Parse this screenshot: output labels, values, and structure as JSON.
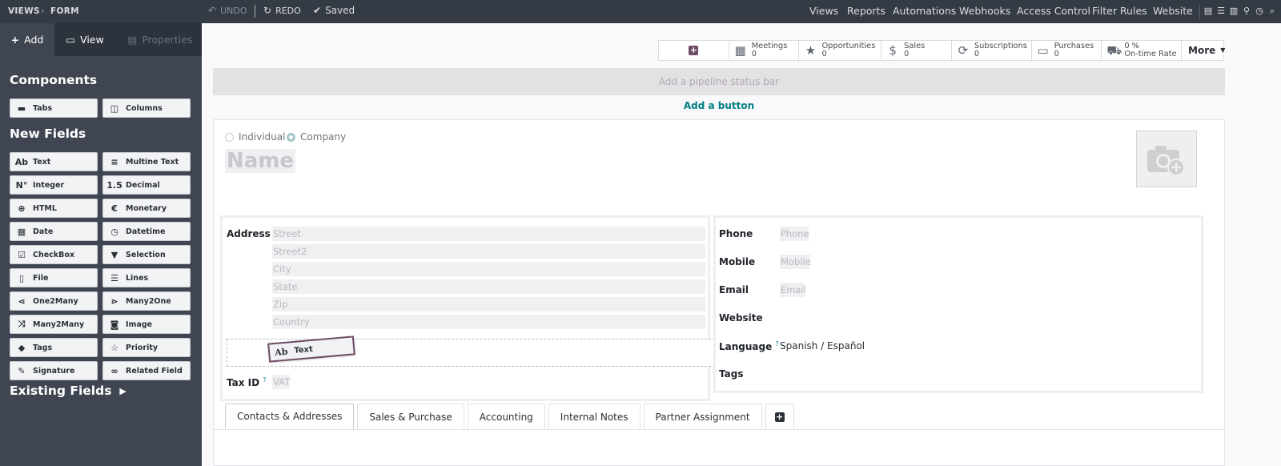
{
  "topbar": {
    "breadcrumb": "VIEWS",
    "crumb_sep": "›",
    "current": "FORM",
    "undo": "UNDO",
    "redo": "REDO",
    "saved": "Saved",
    "menu": [
      "Views",
      "Reports",
      "Automations",
      "Webhooks",
      "Access Control",
      "Filter Rules",
      "Website"
    ]
  },
  "sidebar": {
    "tabs": [
      {
        "label": "Add",
        "icon": "plus-icon"
      },
      {
        "label": "View",
        "icon": "monitor-icon"
      },
      {
        "label": "Properties",
        "icon": "sliders-icon"
      }
    ],
    "components_title": "Components",
    "components": [
      {
        "label": "Tabs",
        "icon": "tabs-icon"
      },
      {
        "label": "Columns",
        "icon": "columns-icon"
      }
    ],
    "new_fields_title": "New Fields",
    "new_fields": [
      {
        "label": "Text",
        "glyph": "Ab"
      },
      {
        "label": "Multine Text",
        "glyph": "≡"
      },
      {
        "label": "Integer",
        "glyph": "N°"
      },
      {
        "label": "Decimal",
        "glyph": "1.5"
      },
      {
        "label": "HTML",
        "glyph": "⊕"
      },
      {
        "label": "Monetary",
        "glyph": "€"
      },
      {
        "label": "Date",
        "glyph": "▦"
      },
      {
        "label": "Datetime",
        "glyph": "◷"
      },
      {
        "label": "CheckBox",
        "glyph": "☑"
      },
      {
        "label": "Selection",
        "glyph": "▼"
      },
      {
        "label": "File",
        "glyph": "▯"
      },
      {
        "label": "Lines",
        "glyph": "☰"
      },
      {
        "label": "One2Many",
        "glyph": "⋖"
      },
      {
        "label": "Many2One",
        "glyph": "⋗"
      },
      {
        "label": "Many2Many",
        "glyph": "⤨"
      },
      {
        "label": "Image",
        "glyph": "◙"
      },
      {
        "label": "Tags",
        "glyph": "◆"
      },
      {
        "label": "Priority",
        "glyph": "☆"
      },
      {
        "label": "Signature",
        "glyph": "✎"
      },
      {
        "label": "Related Field",
        "glyph": "∞"
      }
    ],
    "existing_fields_title": "Existing Fields"
  },
  "stat_buttons": [
    {
      "label": "",
      "value": "",
      "icon": "plus-square-icon"
    },
    {
      "label": "Meetings",
      "value": "0",
      "icon": "calendar-icon"
    },
    {
      "label": "Opportunities",
      "value": "0",
      "icon": "star-icon"
    },
    {
      "label": "Sales",
      "value": "0",
      "icon": "dollar-icon"
    },
    {
      "label": "Subscriptions",
      "value": "0",
      "icon": "refresh-icon"
    },
    {
      "label": "Purchases",
      "value": "0",
      "icon": "credit-card-icon"
    },
    {
      "label": "On-time Rate",
      "value": "0 %",
      "icon": "truck-icon"
    }
  ],
  "more_label": "More",
  "pipeline_placeholder": "Add a pipeline status bar",
  "add_button_label": "Add a button",
  "form": {
    "radio_individual": "Individual",
    "radio_company": "Company",
    "name_placeholder": "Name",
    "address_label": "Address",
    "address_fields": [
      "Street",
      "Street2",
      "City",
      "State",
      "Zip",
      "Country"
    ],
    "drag_label": "Text",
    "drag_glyph": "Ab",
    "tax_id_label": "Tax ID",
    "tax_id_help": "?",
    "vat_placeholder": "VAT",
    "phone_label": "Phone",
    "phone_placeholder": "Phone",
    "mobile_label": "Mobile",
    "mobile_placeholder": "Mobile",
    "email_label": "Email",
    "email_placeholder": "Email",
    "website_label": "Website",
    "language_label": "Language",
    "language_help": "?",
    "language_value": "Spanish / Español",
    "tags_label": "Tags"
  },
  "notebook_tabs": [
    "Contacts & Addresses",
    "Sales & Purchase",
    "Accounting",
    "Internal Notes",
    "Partner Assignment"
  ]
}
